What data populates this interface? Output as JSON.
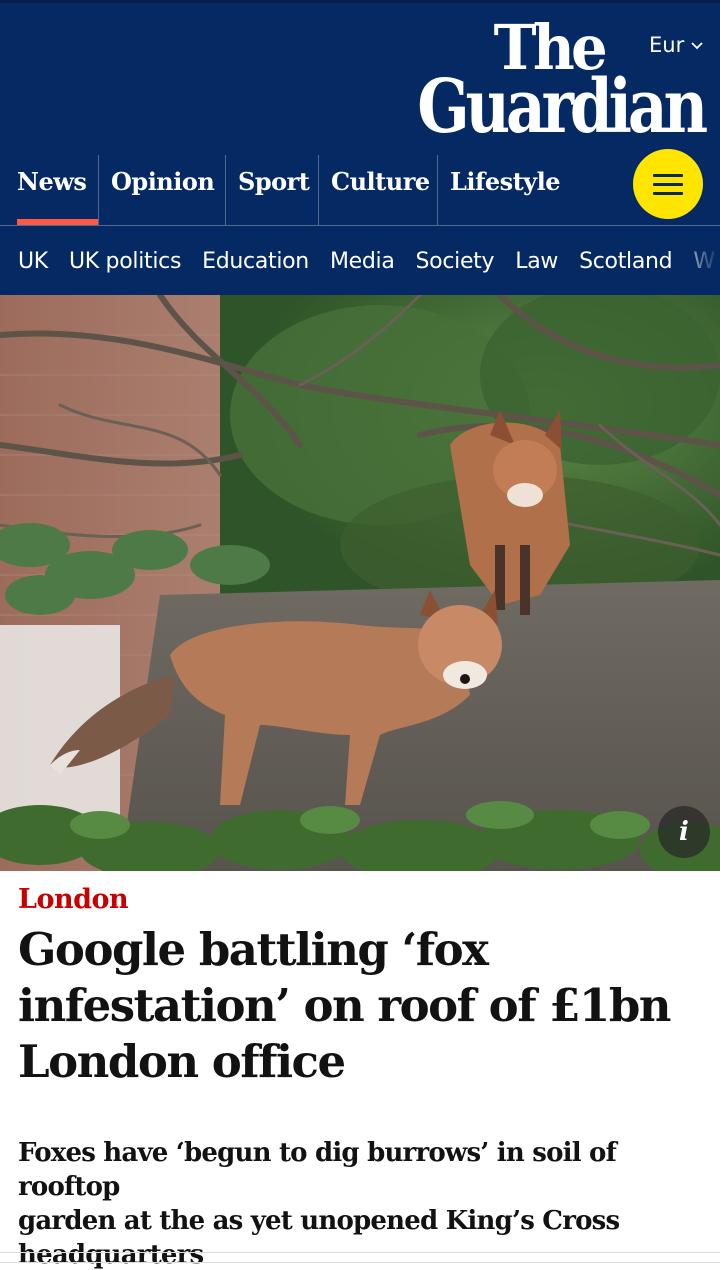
{
  "header": {
    "edition_label": "Eur",
    "logo_line1": "The",
    "logo_line2": "Guardian"
  },
  "pillars": [
    {
      "label": "News",
      "active": true
    },
    {
      "label": "Opinion"
    },
    {
      "label": "Sport"
    },
    {
      "label": "Culture"
    },
    {
      "label": "Lifestyle"
    }
  ],
  "subnav": [
    "UK",
    "UK politics",
    "Education",
    "Media",
    "Society",
    "Law",
    "Scotland",
    "W"
  ],
  "article": {
    "kicker": "London",
    "headline_lines": [
      "Google battling ‘fox",
      "infestation’ on roof of £1bn",
      "London office"
    ],
    "standfirst_lines": [
      "Foxes have ‘begun to dig burrows’ in soil of rooftop",
      "garden at the as yet unopened King’s Cross",
      "headquarters"
    ],
    "image_info_label": "i"
  },
  "colors": {
    "brand_blue": "#052962",
    "news_red": "#c70000",
    "active_underline": "#ff5943",
    "menu_yellow": "#ffe500"
  },
  "icons": {
    "edition": "chevron-down-icon",
    "menu": "hamburger-menu-icon",
    "info": "info-icon"
  }
}
